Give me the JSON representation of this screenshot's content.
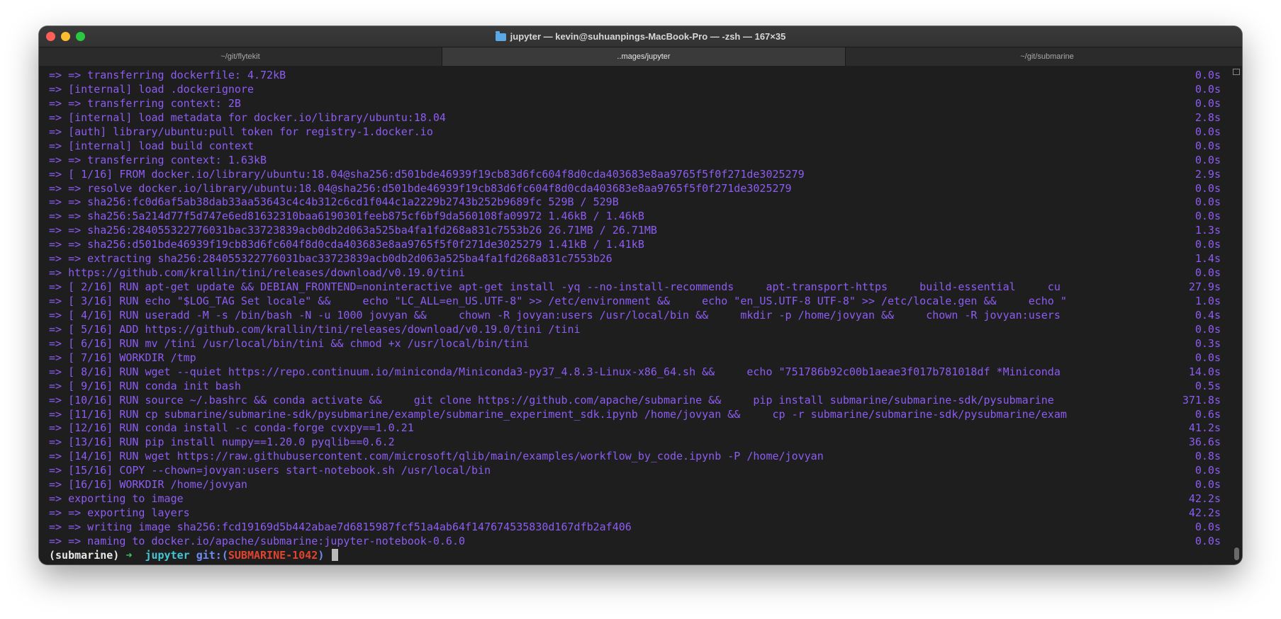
{
  "window": {
    "title": "jupyter — kevin@suhuanpings-MacBook-Pro — -zsh — 167×35"
  },
  "tabs": [
    {
      "label": "~/git/flytekit",
      "active": false
    },
    {
      "label": "..mages/jupyter",
      "active": true
    },
    {
      "label": "~/git/submarine",
      "active": false
    }
  ],
  "tab_add_label": "+",
  "terminal": {
    "text_color": "#8d5cf2",
    "lines": [
      {
        "text": "=> => transferring dockerfile: 4.72kB",
        "time": "0.0s"
      },
      {
        "text": "=> [internal] load .dockerignore",
        "time": "0.0s"
      },
      {
        "text": "=> => transferring context: 2B",
        "time": "0.0s"
      },
      {
        "text": "=> [internal] load metadata for docker.io/library/ubuntu:18.04",
        "time": "2.8s"
      },
      {
        "text": "=> [auth] library/ubuntu:pull token for registry-1.docker.io",
        "time": "0.0s"
      },
      {
        "text": "=> [internal] load build context",
        "time": "0.0s"
      },
      {
        "text": "=> => transferring context: 1.63kB",
        "time": "0.0s"
      },
      {
        "text": "=> [ 1/16] FROM docker.io/library/ubuntu:18.04@sha256:d501bde46939f19cb83d6fc604f8d0cda403683e8aa9765f5f0f271de3025279",
        "time": "2.9s"
      },
      {
        "text": "=> => resolve docker.io/library/ubuntu:18.04@sha256:d501bde46939f19cb83d6fc604f8d0cda403683e8aa9765f5f0f271de3025279",
        "time": "0.0s"
      },
      {
        "text": "=> => sha256:fc0d6af5ab38dab33aa53643c4c4b312c6cd1f044c1a2229b2743b252b9689fc 529B / 529B",
        "time": "0.0s"
      },
      {
        "text": "=> => sha256:5a214d77f5d747e6ed81632310baa6190301feeb875cf6bf9da560108fa09972 1.46kB / 1.46kB",
        "time": "0.0s"
      },
      {
        "text": "=> => sha256:284055322776031bac33723839acb0db2d063a525ba4fa1fd268a831c7553b26 26.71MB / 26.71MB",
        "time": "1.3s"
      },
      {
        "text": "=> => sha256:d501bde46939f19cb83d6fc604f8d0cda403683e8aa9765f5f0f271de3025279 1.41kB / 1.41kB",
        "time": "0.0s"
      },
      {
        "text": "=> => extracting sha256:284055322776031bac33723839acb0db2d063a525ba4fa1fd268a831c7553b26",
        "time": "1.4s"
      },
      {
        "text": "=> https://github.com/krallin/tini/releases/download/v0.19.0/tini",
        "time": "0.0s"
      },
      {
        "text": "=> [ 2/16] RUN apt-get update && DEBIAN_FRONTEND=noninteractive apt-get install -yq --no-install-recommends     apt-transport-https     build-essential     cu",
        "time": "27.9s"
      },
      {
        "text": "=> [ 3/16] RUN echo \"$LOG_TAG Set locale\" &&     echo \"LC_ALL=en_US.UTF-8\" >> /etc/environment &&     echo \"en_US.UTF-8 UTF-8\" >> /etc/locale.gen &&     echo \"",
        "time": "1.0s"
      },
      {
        "text": "=> [ 4/16] RUN useradd -M -s /bin/bash -N -u 1000 jovyan &&     chown -R jovyan:users /usr/local/bin &&     mkdir -p /home/jovyan &&     chown -R jovyan:users",
        "time": "0.4s"
      },
      {
        "text": "=> [ 5/16] ADD https://github.com/krallin/tini/releases/download/v0.19.0/tini /tini",
        "time": "0.0s"
      },
      {
        "text": "=> [ 6/16] RUN mv /tini /usr/local/bin/tini && chmod +x /usr/local/bin/tini",
        "time": "0.3s"
      },
      {
        "text": "=> [ 7/16] WORKDIR /tmp",
        "time": "0.0s"
      },
      {
        "text": "=> [ 8/16] RUN wget --quiet https://repo.continuum.io/miniconda/Miniconda3-py37_4.8.3-Linux-x86_64.sh &&     echo \"751786b92c00b1aeae3f017b781018df *Miniconda",
        "time": "14.0s"
      },
      {
        "text": "=> [ 9/16] RUN conda init bash",
        "time": "0.5s"
      },
      {
        "text": "=> [10/16] RUN source ~/.bashrc && conda activate &&     git clone https://github.com/apache/submarine &&     pip install submarine/submarine-sdk/pysubmarine",
        "time": "371.8s"
      },
      {
        "text": "=> [11/16] RUN cp submarine/submarine-sdk/pysubmarine/example/submarine_experiment_sdk.ipynb /home/jovyan &&     cp -r submarine/submarine-sdk/pysubmarine/exam",
        "time": "0.6s"
      },
      {
        "text": "=> [12/16] RUN conda install -c conda-forge cvxpy==1.0.21",
        "time": "41.2s"
      },
      {
        "text": "=> [13/16] RUN pip install numpy==1.20.0 pyqlib==0.6.2",
        "time": "36.6s"
      },
      {
        "text": "=> [14/16] RUN wget https://raw.githubusercontent.com/microsoft/qlib/main/examples/workflow_by_code.ipynb -P /home/jovyan",
        "time": "0.8s"
      },
      {
        "text": "=> [15/16] COPY --chown=jovyan:users start-notebook.sh /usr/local/bin",
        "time": "0.0s"
      },
      {
        "text": "=> [16/16] WORKDIR /home/jovyan",
        "time": "0.0s"
      },
      {
        "text": "=> exporting to image",
        "time": "42.2s"
      },
      {
        "text": "=> => exporting layers",
        "time": "42.2s"
      },
      {
        "text": "=> => writing image sha256:fcd19169d5b442abae7d6815987fcf51a4ab64f147674535830d167dfb2af406",
        "time": "0.0s"
      },
      {
        "text": "=> => naming to docker.io/apache/submarine:jupyter-notebook-0.6.0",
        "time": "0.0s"
      }
    ],
    "prompt": {
      "env": "(submarine)",
      "arrow": "➜",
      "dir": "jupyter",
      "git_label": "git:(",
      "branch": "SUBMARINE-1042",
      "git_close": ")"
    }
  }
}
